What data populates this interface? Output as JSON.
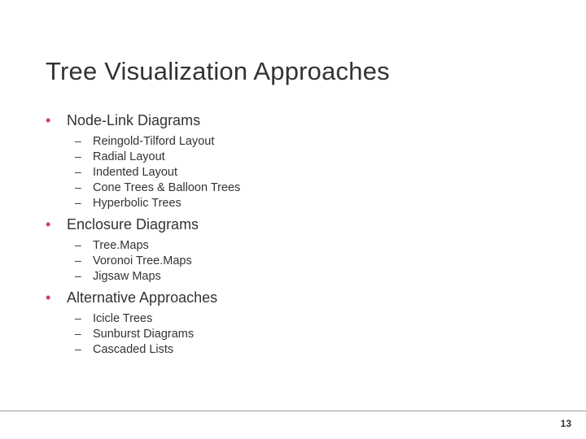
{
  "title": "Tree Visualization Approaches",
  "sections": [
    {
      "label": "Node-Link Diagrams",
      "items": [
        "Reingold-Tilford Layout",
        "Radial Layout",
        "Indented Layout",
        "Cone Trees & Balloon Trees",
        "Hyperbolic Trees"
      ]
    },
    {
      "label": "Enclosure Diagrams",
      "items": [
        "Tree.Maps",
        "Voronoi Tree.Maps",
        "Jigsaw Maps"
      ]
    },
    {
      "label": "Alternative Approaches",
      "items": [
        "Icicle Trees",
        "Sunburst Diagrams",
        "Cascaded Lists"
      ]
    }
  ],
  "page_number": "13"
}
